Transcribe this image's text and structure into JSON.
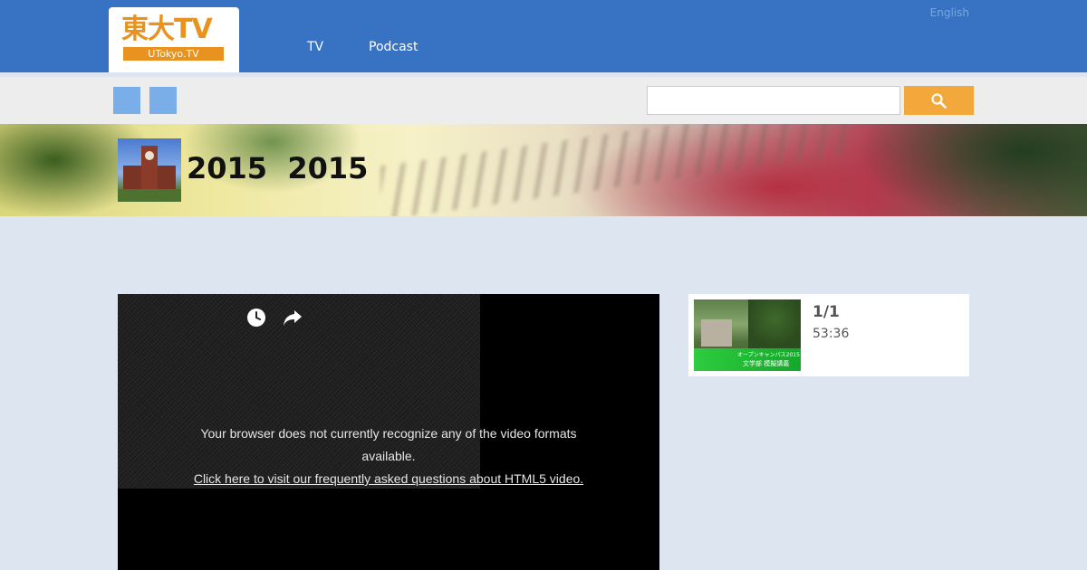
{
  "header": {
    "logo_main": "東大TV",
    "logo_sub": "UTokyo.TV",
    "nav": [
      {
        "label": "TV"
      },
      {
        "label": "Podcast"
      }
    ],
    "language_link": "English"
  },
  "toolbar": {
    "search_value": "",
    "search_placeholder": ""
  },
  "banner": {
    "title": "2015  2015"
  },
  "player": {
    "message": "Your browser does not currently recognize any of the video formats available.",
    "faq_link": "Click here to visit our frequently asked questions about HTML5 video."
  },
  "playlist": [
    {
      "index": "1/1",
      "duration": "53:36",
      "thumb_caption_1": "オープンキャンパス2015",
      "thumb_caption_2": "文学部 模擬講義"
    }
  ],
  "colors": {
    "header_blue": "#3872c2",
    "logo_orange": "#e8931f",
    "search_button": "#f3a83c",
    "toolbar_square": "#7aaee8",
    "page_background": "#dde6f0"
  }
}
